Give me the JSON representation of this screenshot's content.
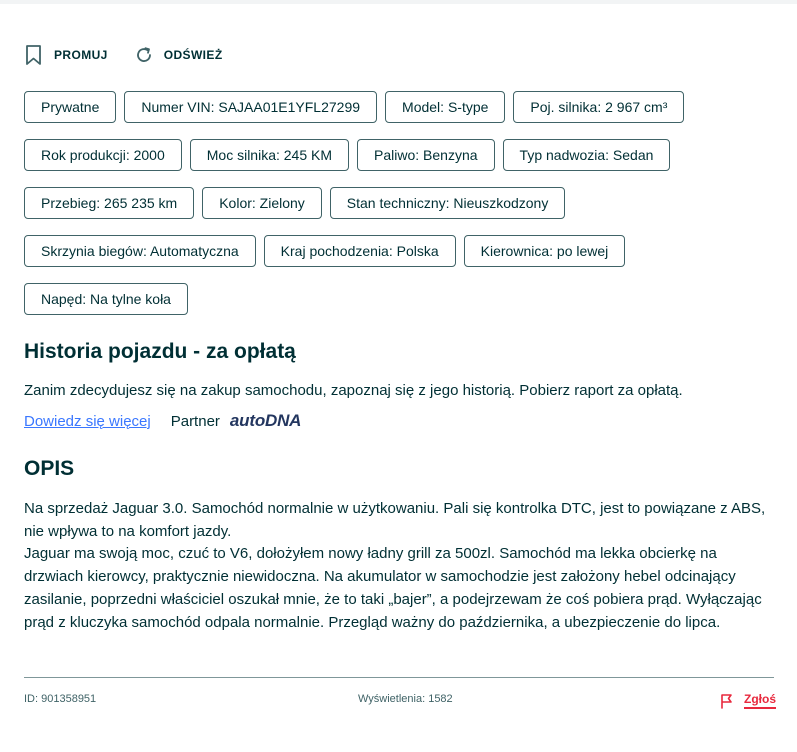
{
  "actions": {
    "promote_label": "PROMUJ",
    "refresh_label": "ODŚWIEŻ"
  },
  "params": [
    "Prywatne",
    "Numer VIN: SAJAA01E1YFL27299",
    "Model: S-type",
    "Poj. silnika: 2 967 cm³",
    "Rok produkcji: 2000",
    "Moc silnika: 245 KM",
    "Paliwo: Benzyna",
    "Typ nadwozia: Sedan",
    "Przebieg: 265 235 km",
    "Kolor: Zielony",
    "Stan techniczny: Nieuszkodzony",
    "Skrzynia biegów: Automatyczna",
    "Kraj pochodzenia: Polska",
    "Kierownica: po lewej",
    "Napęd: Na tylne koła"
  ],
  "history": {
    "title": "Historia pojazdu - za opłatą",
    "text": "Zanim zdecydujesz się na zakup samochodu, zapoznaj się z jego historią. Pobierz raport za opłatą.",
    "link_label": "Dowiedz się więcej",
    "partner_label": "Partner",
    "partner_logo": "autoDNA"
  },
  "description": {
    "title": "OPIS",
    "text": "Na sprzedaż Jaguar 3.0. Samochód normalnie w użytkowaniu. Pali się kontrolka DTC, jest to powiązane z ABS, nie wpływa to na komfort jazdy.\nJaguar ma swoją moc, czuć to V6, dołożyłem nowy ładny grill za 500zl. Samochód ma lekka obcierkę na drzwiach kierowcy, praktycznie niewidoczna. Na akumulator w samochodzie jest założony hebel odcinający zasilanie, poprzedni właściciel oszukał mnie, że to taki „bajer”, a podejrzewam że coś pobiera prąd. Wyłączając prąd z kluczyka samochód odpala normalnie. Przegląd ważny do października, a ubezpieczenie do lipca."
  },
  "footer": {
    "id_text": "ID: 901358951",
    "views_text": "Wyświetlenia: 1582",
    "report_label": "Zgłoś"
  },
  "icons": {
    "promote": "bookmark-icon",
    "refresh": "refresh-icon",
    "report": "flag-icon"
  },
  "colors": {
    "text": "#002f34",
    "link": "#3a77ff",
    "report": "#e8283d",
    "border": "#406367"
  }
}
